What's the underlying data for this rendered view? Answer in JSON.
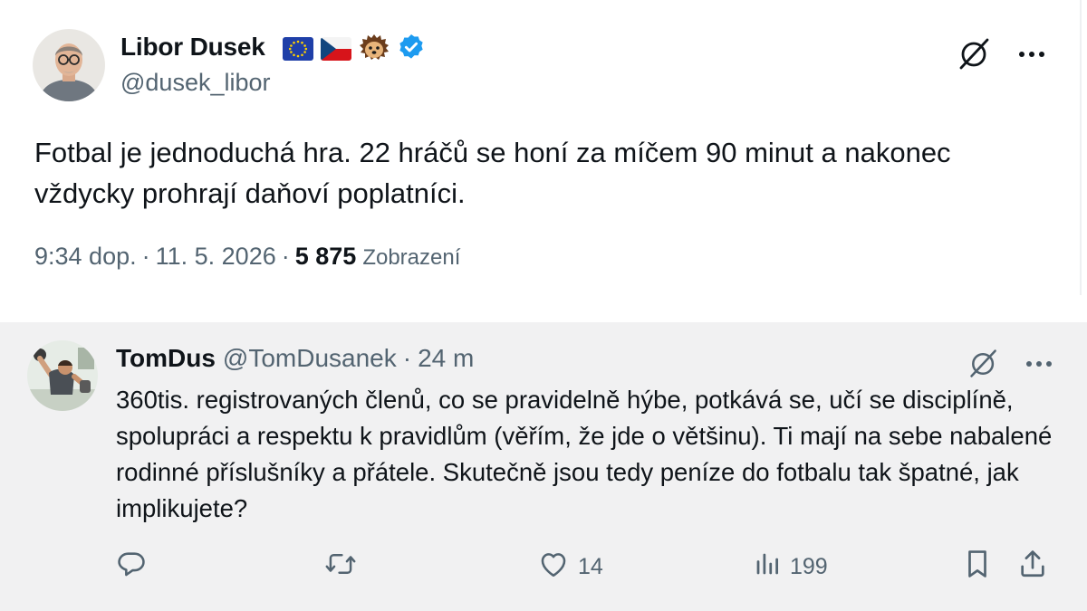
{
  "tweet": {
    "author": {
      "name": "Libor Dusek",
      "handle": "@dusek_libor",
      "badges": [
        "eu-flag-icon",
        "czech-flag-icon",
        "hedgehog-emoji-icon",
        "verified-badge-icon"
      ]
    },
    "text": "Fotbal je jednoduchá hra. 22 hráčů se honí za míčem 90 minut a nakonec vždycky prohrají daňoví poplatníci.",
    "time": "9:34 dop.",
    "date": "11. 5. 2026",
    "separator": "·",
    "views": "5 875",
    "views_label": "Zobrazení",
    "icons": [
      "grok-icon",
      "more-icon"
    ]
  },
  "reply": {
    "author": {
      "name": "TomDus",
      "handle": "@TomDusanek"
    },
    "separator": "·",
    "time": "24 m",
    "text": "360tis. registrovaných členů, co se pravidelně hýbe, potkává se, učí se disciplíně, spolupráci a respektu k pravidlům (věřím, že jde o většinu). Ti mají na sebe nabalené rodinné příslušníky a přátele. Skutečně jsou tedy peníze do fotbalu tak špatné, jak implikujete?",
    "stats": {
      "likes": "14",
      "views": "199"
    },
    "icons": [
      "reply-icon",
      "repost-icon",
      "like-icon",
      "views-icon",
      "bookmark-icon",
      "share-icon"
    ]
  },
  "colors": {
    "text": "#0f1419",
    "secondary": "#536471",
    "verified": "#1d9bf0",
    "reply_background": "#f1f1f2"
  }
}
